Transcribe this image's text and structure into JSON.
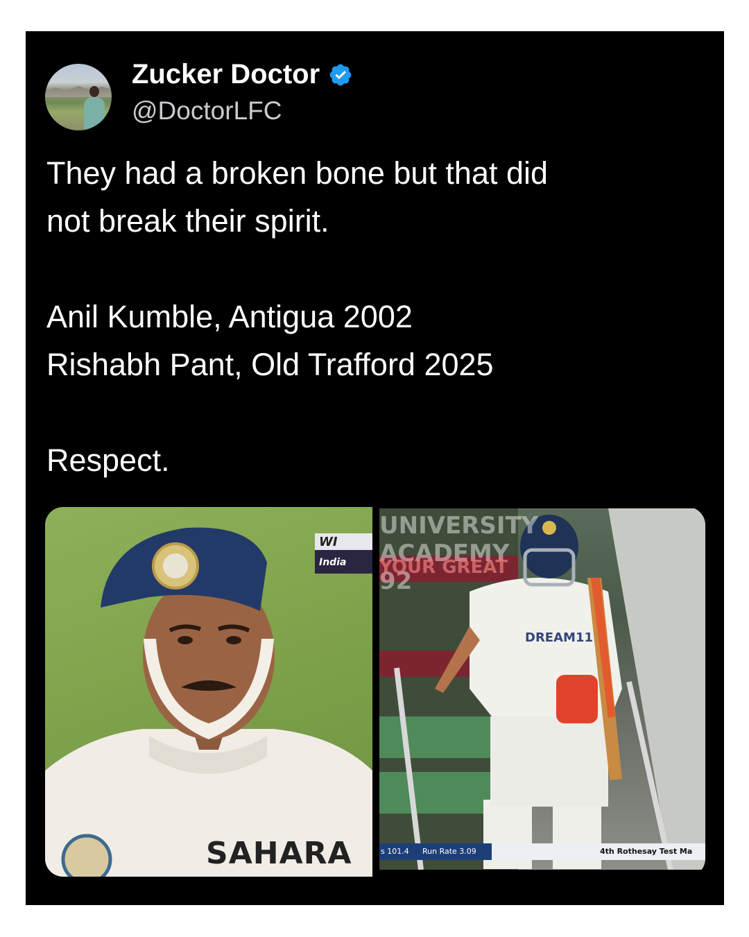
{
  "tweet": {
    "author_name": "Zucker Doctor",
    "handle": "@DoctorLFC",
    "verified": true,
    "accent_color": "#1d9bf0",
    "text_lines": [
      "They had a broken bone but that did",
      "not break their spirit.",
      "",
      "Anil Kumble, Antigua 2002",
      "Rishabh Pant, Old Trafford 2025",
      "",
      "Respect."
    ]
  },
  "media": {
    "left_image": {
      "score_tag_team1": "WI",
      "score_tag_team2": "India",
      "shirt_sponsor": "SAHARA"
    },
    "right_image": {
      "board_text_1": "UNIVERSITY ACADEMY 92",
      "board_text_2": "YOUR GREAT",
      "shirt_sponsor": "DREAM11",
      "ticker_score": "s 101.4",
      "ticker_run_rate": "Run Rate 3.09",
      "ticker_match": "4th Rothesay Test Ma"
    }
  }
}
